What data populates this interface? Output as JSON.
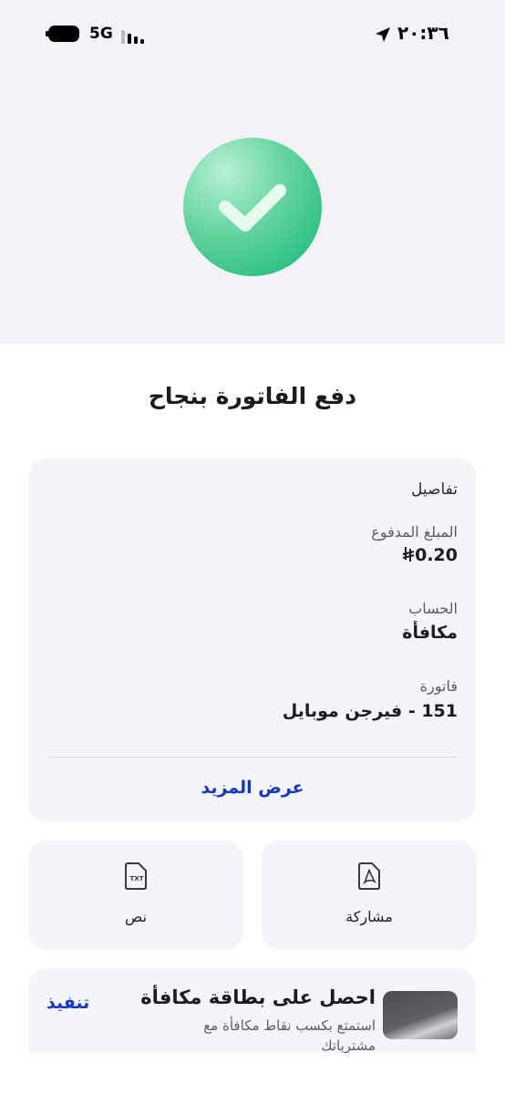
{
  "status_bar": {
    "time": "٢٠:٣٦",
    "network": "5G"
  },
  "header": {
    "title": "دفع الفاتورة بنجاح"
  },
  "details": {
    "section_title": "تفاصيل",
    "amount_label": "المبلغ المدفوع",
    "amount_value": "0.20",
    "account_label": "الحساب",
    "account_value": "مكافأة",
    "bill_label": "فاتورة",
    "bill_value": "151 - فيرجن موبايل",
    "show_more": "عرض المزيد"
  },
  "actions": {
    "share_label": "مشاركة",
    "share_icon": "pdf-file-icon",
    "text_label": "نص",
    "text_icon": "txt-file-icon",
    "text_icon_caption": "TXT"
  },
  "promo": {
    "title": "احصل على بطاقة مكافأة",
    "subtitle": "استمتع بكسب نقاط مكافأة مع مشترياتك",
    "action": "تنفيذ"
  },
  "colors": {
    "accent": "#1436c5",
    "success": "#10b774",
    "card_bg": "#f4f5f9"
  }
}
